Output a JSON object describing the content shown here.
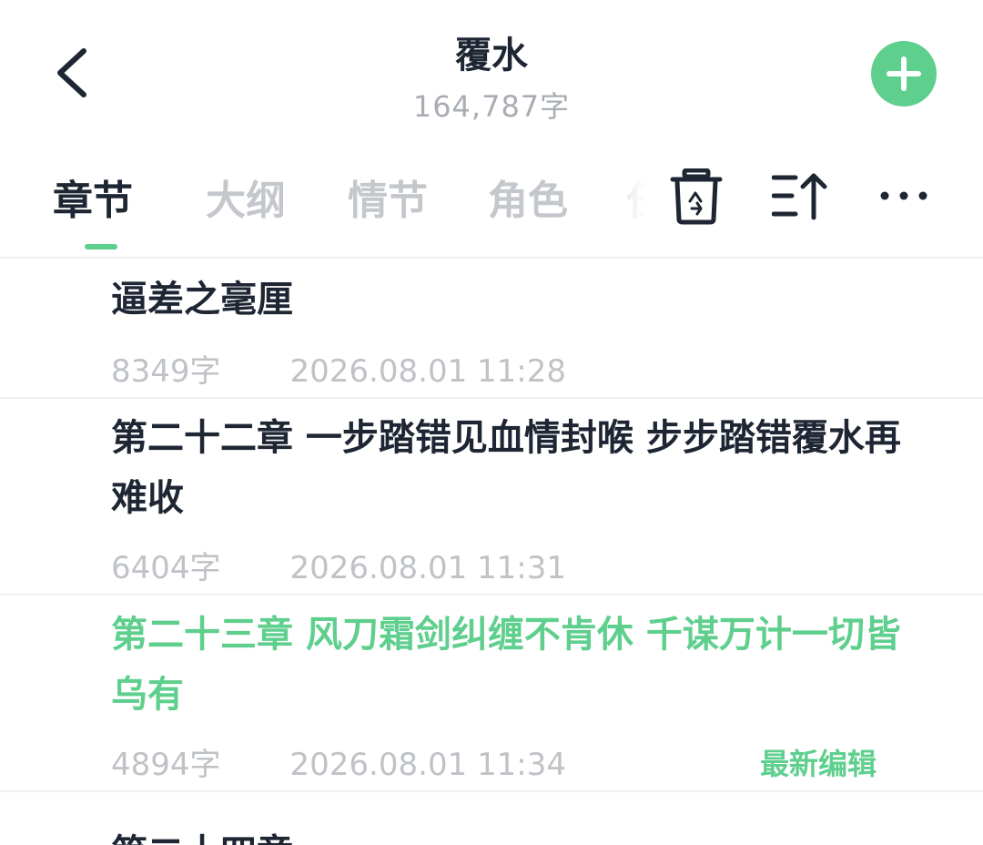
{
  "header": {
    "title": "覆水",
    "word_count": "164,787字"
  },
  "tabs": [
    {
      "label": "章节",
      "active": true
    },
    {
      "label": "大纲",
      "active": false
    },
    {
      "label": "情节",
      "active": false
    },
    {
      "label": "角色",
      "active": false
    },
    {
      "label": "任",
      "active": false
    }
  ],
  "toolbar": {
    "icons": [
      "recycle-bin-icon",
      "sort-icon",
      "more-icon"
    ]
  },
  "colors": {
    "accent": "#5fcf8d",
    "text": "#1f2633",
    "muted": "#bfc2c6"
  },
  "chapters": [
    {
      "title": "逼差之毫厘",
      "words": "8349字",
      "time": "2026.08.01 11:28"
    },
    {
      "title": "第二十二章 一步踏错见血情封喉 步步踏错覆水再难收",
      "words": "6404字",
      "time": "2026.08.01 11:31"
    },
    {
      "title": "第二十三章 风刀霜剑纠缠不肯休 千谋万计一切皆乌有",
      "words": "4894字",
      "time": "2026.08.01 11:34",
      "badge": "最新编辑"
    },
    {
      "title": "第二十四章"
    }
  ]
}
